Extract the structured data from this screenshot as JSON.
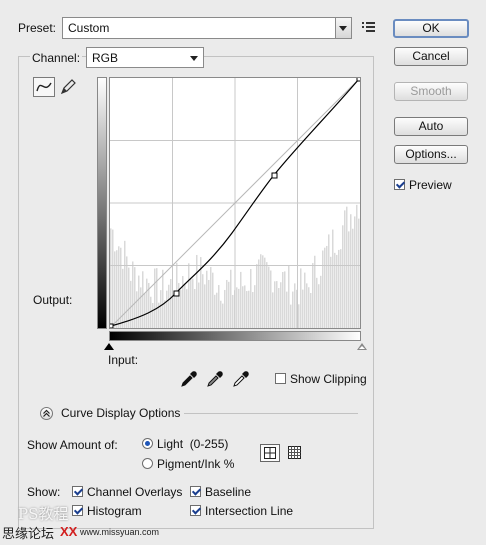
{
  "preset": {
    "label": "Preset:",
    "value": "Custom"
  },
  "channel": {
    "label": "Channel:",
    "value": "RGB"
  },
  "buttons": {
    "ok": "OK",
    "cancel": "Cancel",
    "smooth": "Smooth",
    "auto": "Auto",
    "options": "Options..."
  },
  "preview": {
    "label": "Preview",
    "checked": true
  },
  "graph": {
    "output_label": "Output:",
    "input_label": "Input:",
    "show_clipping": "Show Clipping"
  },
  "curve_display": {
    "title": "Curve Display Options"
  },
  "show_amount": {
    "label": "Show Amount of:",
    "light": "Light  (0-255)",
    "pigment": "Pigment/Ink %"
  },
  "show": {
    "label": "Show:",
    "channel_overlays": "Channel Overlays",
    "baseline": "Baseline",
    "histogram": "Histogram",
    "intersection_line": "Intersection Line"
  },
  "watermark": {
    "line1": "PS教程",
    "line2": "思缘论坛",
    "line3": "www.missyuan.com",
    "xx": "XX"
  },
  "colors": {
    "curve": "#000000",
    "grid": "#c8c8c8",
    "histogram": "#d9d9d9",
    "accent": "#6a8cc0"
  }
}
